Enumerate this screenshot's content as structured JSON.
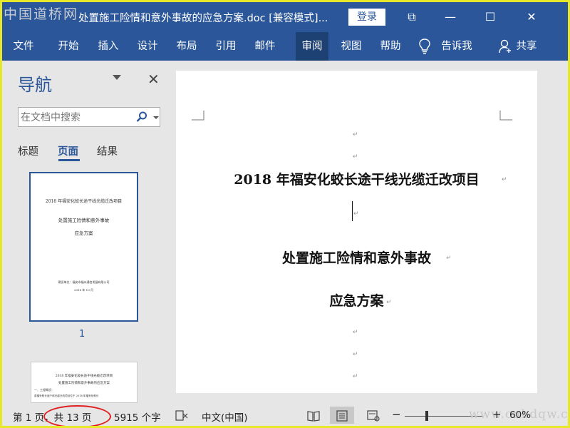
{
  "watermark_top": "中国道桥网",
  "window": {
    "title": "处置施工险情和意外事故的应急方案.doc [兼容模式]...",
    "login_label": "登录",
    "restore_glyph": "⧉",
    "minimize_glyph": "—",
    "maximize_glyph": "☐",
    "close_glyph": "✕"
  },
  "ribbon": {
    "tabs": [
      "文件",
      "开始",
      "插入",
      "设计",
      "布局",
      "引用",
      "邮件",
      "审阅",
      "视图",
      "帮助"
    ],
    "active_tab": "审阅",
    "tell_me": "告诉我",
    "share": "共享"
  },
  "nav": {
    "title": "导航",
    "close_glyph": "✕",
    "search_placeholder": "在文档中搜索",
    "tabs": [
      "标题",
      "页面",
      "结果"
    ],
    "active_tab": "页面",
    "page_number": "1",
    "thumb1": {
      "line1": "2018 年福安化蛟长途干线光缆迁改项目",
      "line2": "处置施工险情和意外事故",
      "line3": "应急方案",
      "line4": "建设单位：福安市福州通信发展有限公司",
      "line5": "2018 年 10 月"
    },
    "thumb2": {
      "line1": "2018 年福安化蛟长途干线光缆迁改项目",
      "line2": "处置施工险情和意外事故的应急方案",
      "line3": "一、工程概况：",
      "line4": "原福安蛟长途干线光缆迁改项目位于 2018 年福安化蛟长"
    }
  },
  "document": {
    "heading1": "2018 年福安化蛟长途干线光缆迁改项目",
    "heading2": "处置施工险情和意外事故",
    "heading3": "应急方案",
    "para_mark": "↵"
  },
  "status": {
    "page": "第 1 页，共 13 页",
    "words": "5915 个字",
    "language": "中文(中国)",
    "zoom_minus": "−",
    "zoom_plus": "+",
    "zoom": "60%",
    "zoom_level": 0.3
  },
  "watermark_bottom": "www.cnbdqw.com",
  "colors": {
    "accent": "#2b579a",
    "highlight": "#e02020",
    "frame": "#e8e82a"
  }
}
